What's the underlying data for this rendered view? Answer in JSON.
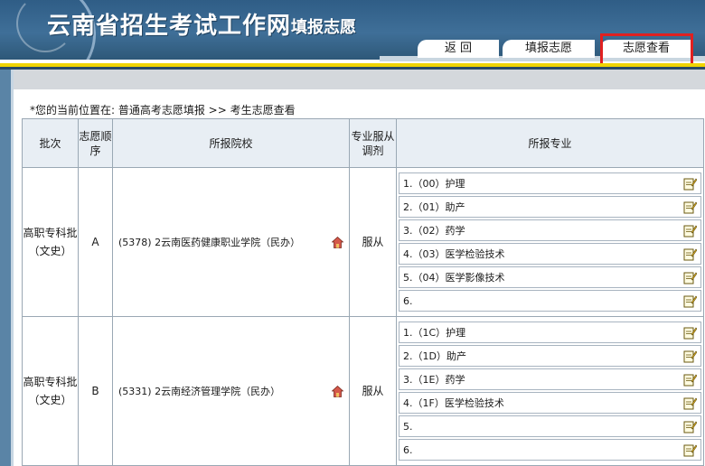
{
  "header": {
    "site_title": "云南省招生考试工作网",
    "site_subtitle": "填报志愿"
  },
  "nav": {
    "tabs": [
      {
        "label": "返 回"
      },
      {
        "label": "填报志愿"
      },
      {
        "label": "志愿查看"
      }
    ]
  },
  "breadcrumb": "*您的当前位置在: 普通高考志愿填报 >> 考生志愿查看",
  "table": {
    "headers": {
      "batch": "批次",
      "order": "志愿顺序",
      "school": "所报院校",
      "obey": "专业服从调剂",
      "majors": "所报专业"
    },
    "rows": [
      {
        "batch": "高职专科批（文史）",
        "order": "A",
        "school": "(5378) 2云南医药健康职业学院（民办）",
        "obey": "服从",
        "majors": [
          "1.（00）护理",
          "2.（01）助产",
          "3.（02）药学",
          "4.（03）医学检验技术",
          "5.（04）医学影像技术",
          "6."
        ]
      },
      {
        "batch": "高职专科批（文史）",
        "order": "B",
        "school": "(5331) 2云南经济管理学院（民办）",
        "obey": "服从",
        "majors": [
          "1.（1C）护理",
          "2.（1D）助产",
          "3.（1E）药学",
          "4.（1F）医学检验技术",
          "5.",
          "6."
        ]
      }
    ]
  },
  "colors": {
    "header_blue": "#3f6f98",
    "accent_yellow": "#f0d400",
    "highlight_red": "#e02020"
  }
}
